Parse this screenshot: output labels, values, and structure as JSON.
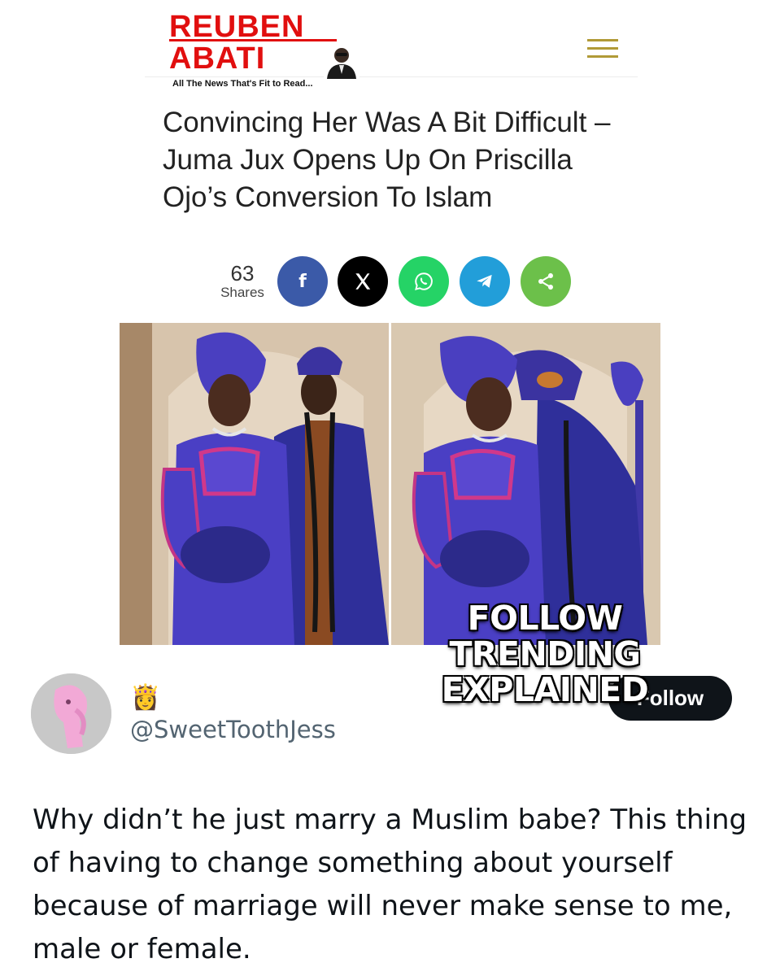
{
  "site": {
    "logo_line1": "REUBEN",
    "logo_line2": "ABATI",
    "tagline": "All The News That's Fit to Read...",
    "brand_color": "#e10f0f",
    "menu_icon": "hamburger-menu-icon"
  },
  "article": {
    "headline": "Convincing Her Was A Bit Difficult – Juma Jux Opens Up On Priscilla Ojo’s Conversion To Islam"
  },
  "share_bar": {
    "count": "63",
    "label": "Shares",
    "buttons": [
      {
        "icon": "facebook-icon",
        "glyph": "f",
        "color": "#3b5aa8"
      },
      {
        "icon": "x-icon",
        "glyph": "𝕏",
        "color": "#000000"
      },
      {
        "icon": "whatsapp-icon",
        "color": "#25d366"
      },
      {
        "icon": "telegram-icon",
        "color": "#229ed9"
      },
      {
        "icon": "share-icon",
        "color": "#6cc04a"
      }
    ]
  },
  "overlay": {
    "line1": "FOLLOW",
    "line2": "TRENDING",
    "line3": "EXPLAINED"
  },
  "tweet": {
    "emoji": "👸",
    "handle": "@SweetToothJess",
    "follow_label": "Follow",
    "text": "Why didn’t he just marry a Muslim babe? This thing of having to change something about yourself because of marriage will never make sense to me, male or female."
  }
}
